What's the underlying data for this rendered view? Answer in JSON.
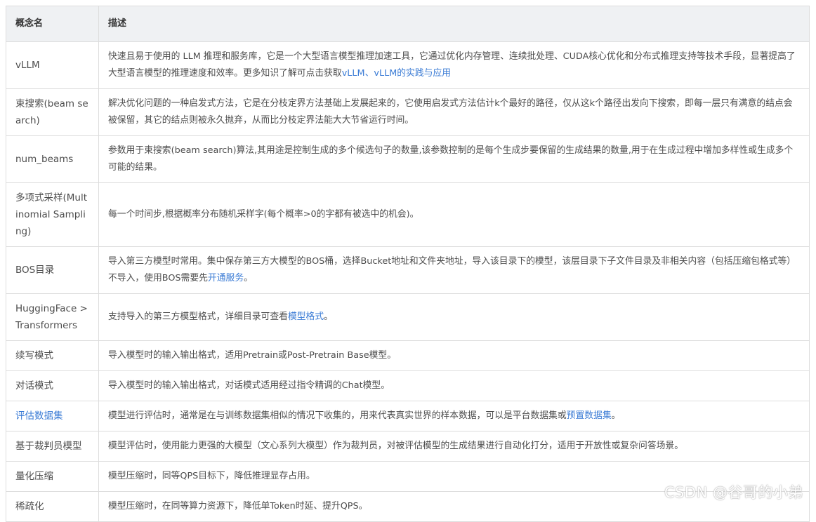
{
  "table": {
    "headers": [
      "概念名",
      "描述"
    ],
    "rows": [
      {
        "name": "vLLM",
        "desc_parts": [
          {
            "text": "快速且易于使用的 LLM 推理和服务库，它是一个大型语言模型推理加速工具，它通过优化内存管理、连续批处理、CUDA核心优化和分布式推理支持等技术手段，显著提高了大型语言模型的推理速度和效率。更多知识了解可点击获取"
          },
          {
            "text": "vLLM、vLLM的实践与应用",
            "link": true
          }
        ]
      },
      {
        "name": "束搜索(beam search)",
        "desc_parts": [
          {
            "text": "解决优化问题的一种启发式方法，它是在分枝定界方法基础上发展起来的，它使用启发式方法估计k个最好的路径，仅从这k个路径出发向下搜索，即每一层只有满意的结点会被保留，其它的结点则被永久抛弃，从而比分枝定界法能大大节省运行时间。"
          }
        ]
      },
      {
        "name": "num_beams",
        "desc_parts": [
          {
            "text": "参数用于束搜索(beam search)算法,其用途是控制生成的多个候选句子的数量,该参数控制的是每个生成步要保留的生成结果的数量,用于在生成过程中增加多样性或生成多个可能的结果。"
          }
        ]
      },
      {
        "name": "多项式采样(Multinomial Sampling)",
        "desc_parts": [
          {
            "text": "每一个时间步,根据概率分布随机采样字(每个概率>0的字都有被选中的机会)。"
          }
        ]
      },
      {
        "name": "BOS目录",
        "desc_parts": [
          {
            "text": "导入第三方模型时常用。集中保存第三方大模型的BOS桶，选择Bucket地址和文件夹地址，导入该目录下的模型，该层目录下子文件目录及非相关内容（包括压缩包格式等）不导入，使用BOS需要先"
          },
          {
            "text": "开通服务",
            "link": true
          },
          {
            "text": "。"
          }
        ]
      },
      {
        "name": "HuggingFace > Transformers",
        "desc_parts": [
          {
            "text": "支持导入的第三方模型格式，详细目录可查看"
          },
          {
            "text": "模型格式",
            "link": true
          },
          {
            "text": "。"
          }
        ]
      },
      {
        "name": "续写模式",
        "desc_parts": [
          {
            "text": "导入模型时的输入输出格式，适用Pretrain或Post-Pretrain Base模型。"
          }
        ]
      },
      {
        "name": "对话模式",
        "desc_parts": [
          {
            "text": "导入模型时的输入输出格式，对话模式适用经过指令精调的Chat模型。"
          }
        ]
      },
      {
        "name": "评估数据集",
        "name_link": true,
        "desc_parts": [
          {
            "text": "模型进行评估时，通常是在与训练数据集相似的情况下收集的，用来代表真实世界的样本数据，可以是平台数据集或"
          },
          {
            "text": "预置数据集",
            "link": true
          },
          {
            "text": "。"
          }
        ]
      },
      {
        "name": "基于裁判员模型",
        "desc_parts": [
          {
            "text": "模型评估时，使用能力更强的大模型（文心系列大模型）作为裁判员，对被评估模型的生成结果进行自动化打分，适用于开放性或复杂问答场景。"
          }
        ]
      },
      {
        "name": "量化压缩",
        "desc_parts": [
          {
            "text": "模型压缩时，同等QPS目标下，降低推理显存占用。"
          }
        ]
      },
      {
        "name": "稀疏化",
        "desc_parts": [
          {
            "text": "模型压缩时，在同等算力资源下，降低单Token时延、提升QPS。"
          }
        ]
      }
    ]
  },
  "watermark": "CSDN @谷哥的小弟",
  "colors": {
    "link": "#3a7bd5",
    "header_bg": "#eff1f3",
    "border": "#dddddd",
    "text": "#4d4d4d"
  }
}
